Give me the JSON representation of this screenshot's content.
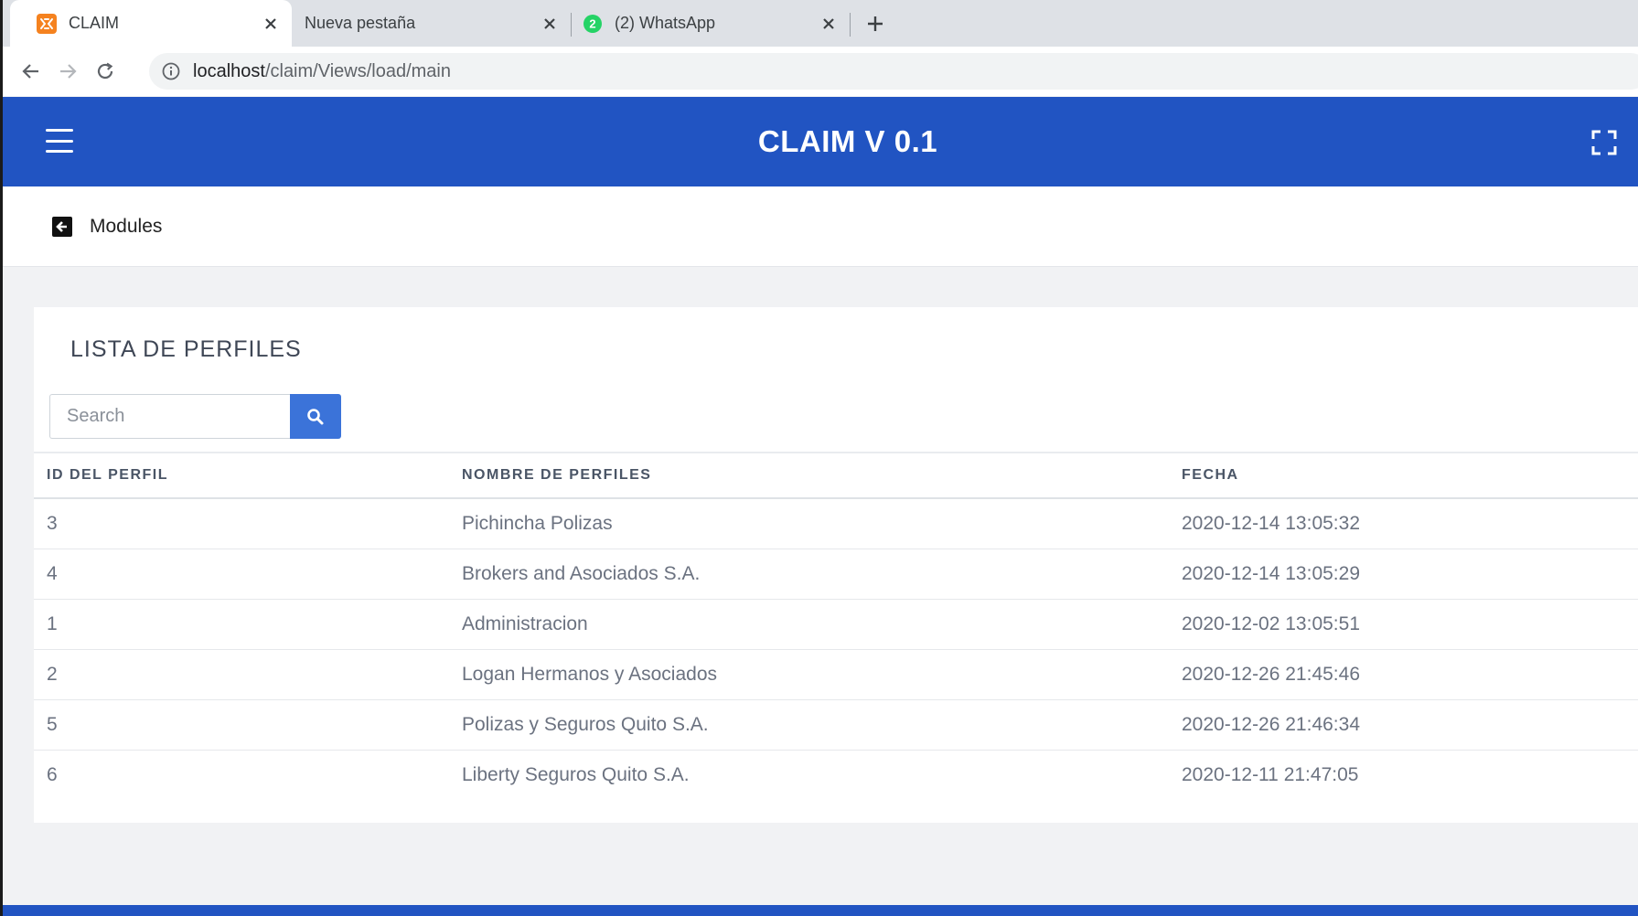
{
  "browser": {
    "tabs": [
      {
        "title": "CLAIM",
        "active": true,
        "favicon": "xampp-icon"
      },
      {
        "title": "Nueva pestaña",
        "active": false,
        "favicon": ""
      },
      {
        "title": "(2) WhatsApp",
        "active": false,
        "favicon": "whatsapp-icon",
        "badge": "2"
      }
    ],
    "url_host": "localhost",
    "url_path": "/claim/Views/load/main"
  },
  "header": {
    "title": "CLAIM V 0.1",
    "color": "#2154c2"
  },
  "breadcrumb": {
    "label": "Modules"
  },
  "card": {
    "title": "LISTA DE PERFILES",
    "search_placeholder": "Search",
    "columns": [
      "ID DEL PERFIL",
      "NOMBRE DE PERFILES",
      "FECHA"
    ],
    "rows": [
      {
        "id": "3",
        "name": "Pichincha Polizas",
        "date": "2020-12-14 13:05:32"
      },
      {
        "id": "4",
        "name": "Brokers and Asociados S.A.",
        "date": "2020-12-14 13:05:29"
      },
      {
        "id": "1",
        "name": "Administracion",
        "date": "2020-12-02 13:05:51"
      },
      {
        "id": "2",
        "name": "Logan Hermanos y Asociados",
        "date": "2020-12-26 21:45:46"
      },
      {
        "id": "5",
        "name": "Polizas y Seguros Quito S.A.",
        "date": "2020-12-26 21:46:34"
      },
      {
        "id": "6",
        "name": "Liberty Seguros Quito S.A.",
        "date": "2020-12-11 21:47:05"
      }
    ]
  }
}
